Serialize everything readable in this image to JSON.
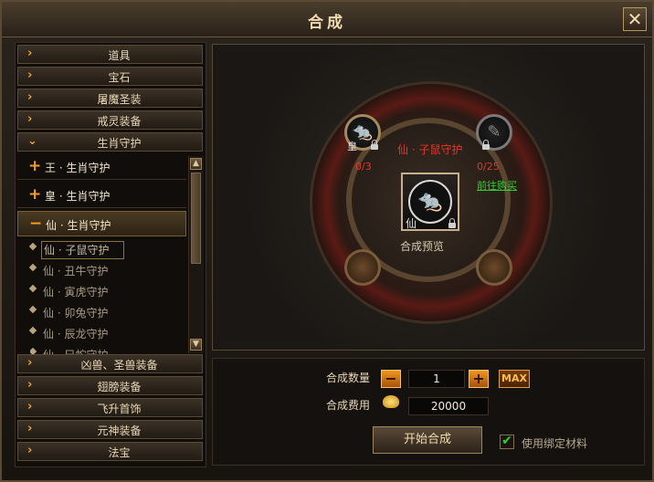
{
  "window": {
    "title": "合成",
    "close_glyph": "✕"
  },
  "categories_top": [
    {
      "label": "道具"
    },
    {
      "label": "宝石"
    },
    {
      "label": "屠魔圣装"
    },
    {
      "label": "戒灵装备"
    },
    {
      "label": "生肖守护"
    }
  ],
  "subgroups": [
    {
      "prefix": "+",
      "label": "王 · 生肖守护"
    },
    {
      "prefix": "+",
      "label": "皇 · 生肖守护"
    },
    {
      "prefix": "−",
      "label": "仙 · 生肖守护"
    }
  ],
  "leaves": [
    {
      "label": "仙 · 子鼠守护"
    },
    {
      "label": "仙 · 丑牛守护"
    },
    {
      "label": "仙 · 寅虎守护"
    },
    {
      "label": "仙 · 卯兔守护"
    },
    {
      "label": "仙 · 辰龙守护"
    },
    {
      "label": "仙 · 巳蛇守护"
    }
  ],
  "categories_bottom": [
    {
      "label": "凶兽、圣兽装备"
    },
    {
      "label": "翅膀装备"
    },
    {
      "label": "飞升首饰"
    },
    {
      "label": "元神装备"
    },
    {
      "label": "法宝"
    }
  ],
  "icons": {
    "expand": "›",
    "collapse": "⌄",
    "leaf": "diamond-icon",
    "scroll_up": "▲",
    "scroll_down": "▼"
  },
  "synth": {
    "material_1": {
      "grade": "皇",
      "count": "0/3",
      "glyph": "🐀"
    },
    "material_2": {
      "count": "0/25",
      "glyph": "✎"
    },
    "target_name": "仙 · 子鼠守护",
    "result": {
      "grade": "仙",
      "glyph": "🐀"
    },
    "preview_label": "合成预览",
    "buy_link": "前往购买"
  },
  "controls": {
    "quantity_label": "合成数量",
    "quantity_value": "1",
    "minus": "−",
    "plus": "+",
    "max_label": "MAX",
    "cost_label": "合成费用",
    "cost_value": "20000",
    "start_label": "开始合成",
    "bind_label": "使用绑定材料",
    "bind_checked": "✔"
  },
  "colors": {
    "accent": "#f3a020",
    "red": "#e0382a",
    "green": "#2fd22f"
  }
}
